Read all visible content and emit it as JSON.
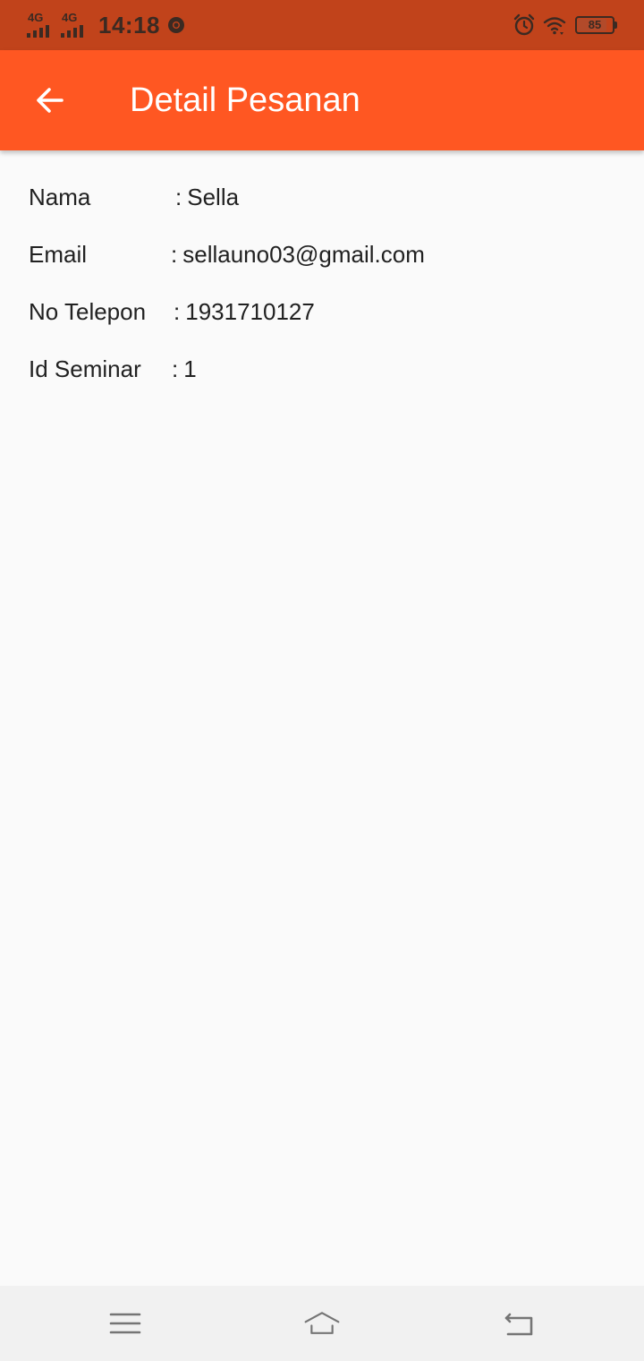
{
  "status_bar": {
    "network_1": "4G",
    "network_2": "4G",
    "time": "14:18",
    "battery": "85",
    "battery_fraction": 0.85,
    "icons": [
      "signal-icon",
      "chrome-icon",
      "alarm-icon",
      "wifi-icon",
      "battery-icon"
    ]
  },
  "app_bar": {
    "title": "Detail Pesanan",
    "back_icon": "arrow-back-icon",
    "background": "#ff5722"
  },
  "details": {
    "nama": {
      "label": "Nama",
      "value": "Sella"
    },
    "email": {
      "label": "Email",
      "value": "sellauno03@gmail.com"
    },
    "telepon": {
      "label": "No Telepon",
      "value": "1931710127"
    },
    "seminar": {
      "label": "Id Seminar",
      "value": "1"
    }
  },
  "nav_bar": {
    "icons": [
      "menu-icon",
      "home-icon",
      "back-icon"
    ]
  },
  "colors": {
    "status_bar": "#c1431b",
    "accent": "#ff5722",
    "background": "#fafafa",
    "text": "#212121"
  }
}
